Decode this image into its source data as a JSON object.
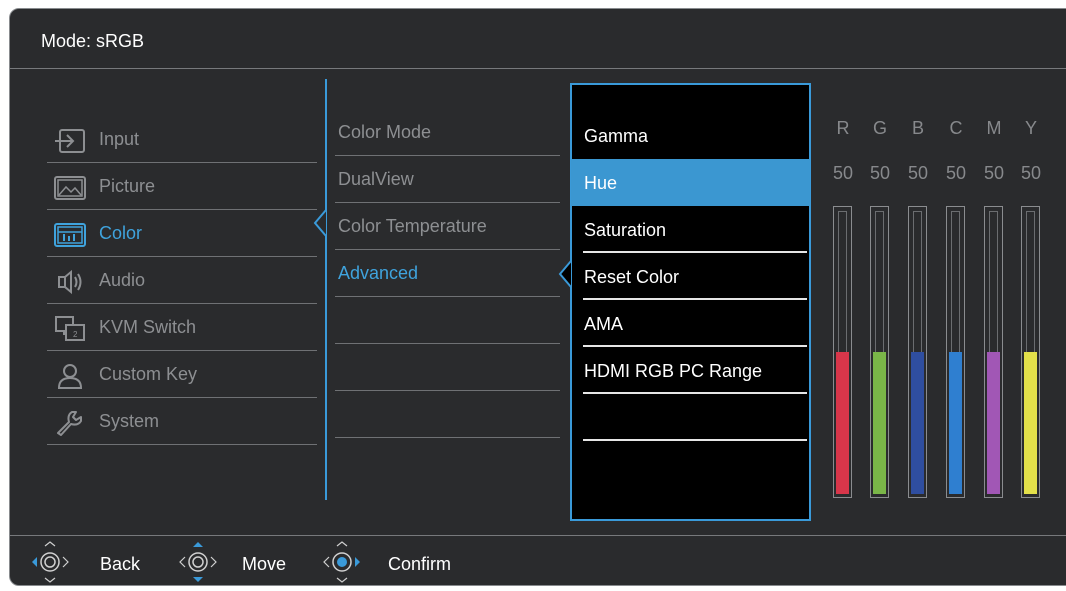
{
  "header": {
    "mode_text": "Mode: sRGB"
  },
  "menu_main": [
    {
      "label": "Input",
      "icon": "input-icon"
    },
    {
      "label": "Picture",
      "icon": "picture-icon"
    },
    {
      "label": "Color",
      "icon": "color-icon",
      "active": true
    },
    {
      "label": "Audio",
      "icon": "speaker-icon"
    },
    {
      "label": "KVM Switch",
      "icon": "kvm-switch-icon"
    },
    {
      "label": "Custom Key",
      "icon": "person-icon"
    },
    {
      "label": "System",
      "icon": "wrench-icon"
    }
  ],
  "menu_color": [
    {
      "label": "Color Mode"
    },
    {
      "label": "DualView"
    },
    {
      "label": "Color Temperature"
    },
    {
      "label": "Advanced",
      "active": true
    }
  ],
  "menu_advanced": [
    {
      "label": "Gamma"
    },
    {
      "label": "Hue",
      "selected": true
    },
    {
      "label": "Saturation"
    },
    {
      "label": "Reset Color"
    },
    {
      "label": "AMA"
    },
    {
      "label": "HDMI RGB PC Range"
    },
    {
      "label": ""
    }
  ],
  "channels": {
    "letters": [
      "R",
      "G",
      "B",
      "C",
      "M",
      "Y"
    ],
    "values": [
      "50",
      "50",
      "50",
      "50",
      "50",
      "50"
    ],
    "levels": [
      50,
      50,
      50,
      50,
      50,
      50
    ],
    "level_max": 100,
    "colors": [
      "#d8364a",
      "#7ab648",
      "#2f4ea0",
      "#2f7fd0",
      "#a157b5",
      "#e3e04a"
    ]
  },
  "footer": {
    "back_label": "Back",
    "move_label": "Move",
    "confirm_label": "Confirm"
  },
  "theme": {
    "accent": "#3a9ad9",
    "background": "#2a2b2d",
    "highlight": "#3b97d1"
  }
}
